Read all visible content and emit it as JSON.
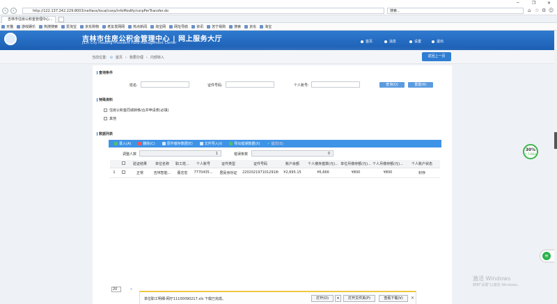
{
  "browser": {
    "url": "http://122.137.242.229:8003/netface/local/corp/infoModify/corpPerTransfer.do",
    "search_placeholder": "搜索...",
    "tab_title": "吉林市住房公积金管理中心...",
    "favorites": [
      "天猫",
      "游戏娱乐",
      "热搜搜索",
      "爱淘宝",
      "京东购物",
      "老友发网网",
      "热点新闻",
      "淘宝网",
      "网址导航",
      "资讯",
      "苏宁易购",
      "搜索",
      "京东",
      "淘宝"
    ]
  },
  "site": {
    "title": "吉林市住房公积金管理中心 | 网上服务大厅",
    "subtitle": "JiLin City Housing Provident Fund Management Center",
    "nav": [
      "首页",
      "消息",
      "设置",
      "退出"
    ]
  },
  "breadcrumb": {
    "label": "当前位置:",
    "items": [
      "首页",
      "我要办理",
      "内部转入"
    ],
    "back_button": "返回上一页"
  },
  "query": {
    "section_title": "查询条件",
    "name_label": "姓名:",
    "id_label": "证件号码:",
    "account_label": "个人账号:",
    "search_button": "查询(Q)",
    "reset_button": "重置(R)"
  },
  "materials": {
    "section_title": "特殊资料",
    "items": [
      "住房公积金同城转移/合并申请表(必填)",
      "其他"
    ]
  },
  "list": {
    "section_title": "数据列表",
    "toolbar": [
      "录入(A)",
      "删除(C)",
      "原件缴存数据(E)",
      "文件导入(I)",
      "导出错误数据(X)",
      "提交(S)"
    ],
    "adjust_count_label": "调整人数",
    "adjust_count_value": "1",
    "error_count_label": "错误条数",
    "error_count_value": "0",
    "columns": [
      "",
      "",
      "验证结果",
      "单位名称",
      "职工姓...",
      "个人账号",
      "证件类型",
      "证件号码",
      "账户余额",
      "个人缴存基数(元)...",
      "单位月缴存额(元)...",
      "个人月缴存额(元)...",
      "个人账户状态"
    ],
    "rows": [
      [
        "1",
        "",
        "正常",
        "吉林智能...",
        "蕾志宏",
        "7770435...",
        "居民身份证",
        "22020219710129184...",
        "¥2,695.15",
        "¥6,666",
        "¥800",
        "¥800",
        "封存"
      ]
    ]
  },
  "pager": {
    "page_size": "20"
  },
  "download": {
    "message": "单位职工明细-网厅11100090217.xls 下载已完成。",
    "open": "打开(O)",
    "open_folder": "打开文件夹(P)",
    "view_downloads": "查看下载(V)"
  },
  "widget": {
    "percent": "30%",
    "speed": "↑ 5.6K/s"
  },
  "watermark": {
    "line1": "激活 Windows",
    "line2": "转到\"设置\"以激活 Windows。"
  }
}
